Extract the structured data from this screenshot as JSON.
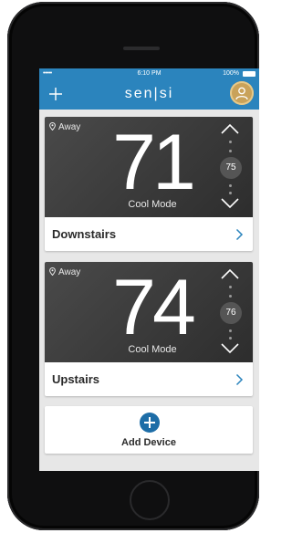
{
  "status_bar": {
    "signal": "•••••",
    "time": "6:10 PM",
    "battery": "100%"
  },
  "header": {
    "add_icon": "plus-icon",
    "brand": "sen|si",
    "avatar_icon": "user-avatar-icon"
  },
  "thermostats": [
    {
      "mode_label": "Away",
      "temperature": "71",
      "setpoint": "75",
      "mode": "Cool Mode",
      "name": "Downstairs"
    },
    {
      "mode_label": "Away",
      "temperature": "74",
      "setpoint": "76",
      "mode": "Cool Mode",
      "name": "Upstairs"
    }
  ],
  "add_device": {
    "label": "Add Device"
  },
  "colors": {
    "accent": "#2b84bd",
    "card_dark": "#3a3a3a",
    "add_button": "#1d6da7",
    "chevron": "#2b84bd"
  }
}
